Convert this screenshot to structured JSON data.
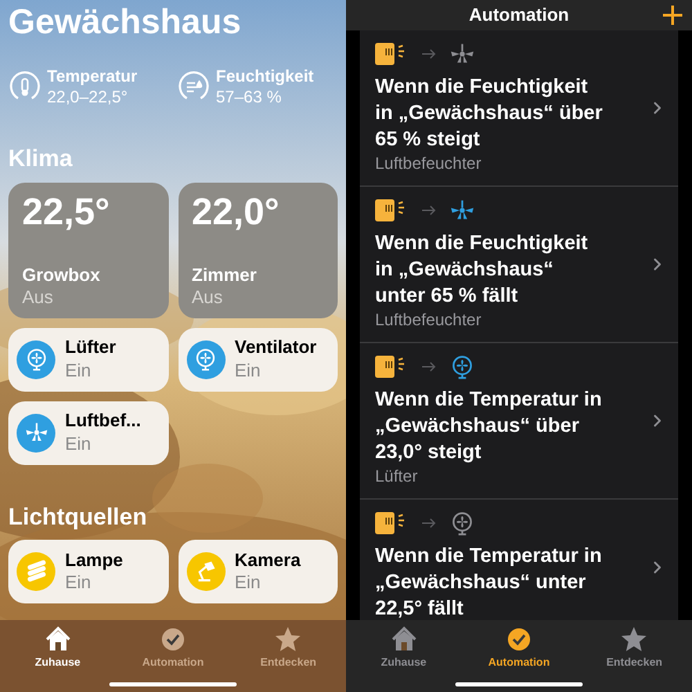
{
  "home": {
    "title": "Gewächshaus",
    "sensors": [
      {
        "kind": "temperature",
        "label": "Temperatur",
        "value": "22,0–22,5°"
      },
      {
        "kind": "humidity",
        "label": "Feuchtigkeit",
        "value": "57–63 %"
      }
    ],
    "sections": [
      {
        "title": "Klima",
        "tiles": [
          {
            "kind": "reading",
            "value": "22,5°",
            "name": "Growbox",
            "status": "Aus"
          },
          {
            "kind": "reading",
            "value": "22,0°",
            "name": "Zimmer",
            "status": "Aus"
          },
          {
            "kind": "fan",
            "color": "#2f9fe0",
            "name": "Lüfter",
            "status": "Ein",
            "on": true
          },
          {
            "kind": "fan",
            "color": "#2f9fe0",
            "name": "Ventilator",
            "status": "Ein",
            "on": true
          },
          {
            "kind": "ceiling-fan",
            "color": "#2f9fe0",
            "name": "Luftbef...",
            "status": "Ein",
            "on": true
          }
        ]
      },
      {
        "title": "Lichtquellen",
        "tiles": [
          {
            "kind": "light-strip",
            "color": "#f7c600",
            "name": "Lampe",
            "status": "Ein",
            "on": true
          },
          {
            "kind": "desk-lamp",
            "color": "#f7c600",
            "name": "Kamera",
            "status": "Ein",
            "on": true
          }
        ]
      }
    ],
    "tab_bar": [
      {
        "kind": "house",
        "label": "Zuhause",
        "selected": true
      },
      {
        "kind": "automation",
        "label": "Automation",
        "selected": false
      },
      {
        "kind": "star",
        "label": "Entdecken",
        "selected": false
      }
    ]
  },
  "automation": {
    "title": "Automation",
    "rules": [
      {
        "kind": "ceiling-fan",
        "active": false,
        "text": "Wenn die Feuchtigkeit in „Gewächshaus“ über 65 % steigt",
        "accessory": "Luftbefeuchter"
      },
      {
        "kind": "ceiling-fan",
        "active": true,
        "text": "Wenn die Feuchtigkeit in „Gewächshaus“ unter 65 % fällt",
        "accessory": "Luftbefeuchter"
      },
      {
        "kind": "fan",
        "active": true,
        "text": "Wenn die Temperatur in „Gewächshaus“ über 23,0° steigt",
        "accessory": "Lüfter"
      },
      {
        "kind": "fan",
        "active": false,
        "text": "Wenn die Temperatur in „Gewächshaus“ unter 22,5° fällt"
      }
    ],
    "tab_bar": [
      {
        "kind": "house",
        "label": "Zuhause",
        "selected": false
      },
      {
        "kind": "automation",
        "label": "Automation",
        "selected": true
      },
      {
        "kind": "star",
        "label": "Entdecken",
        "selected": false
      }
    ]
  }
}
